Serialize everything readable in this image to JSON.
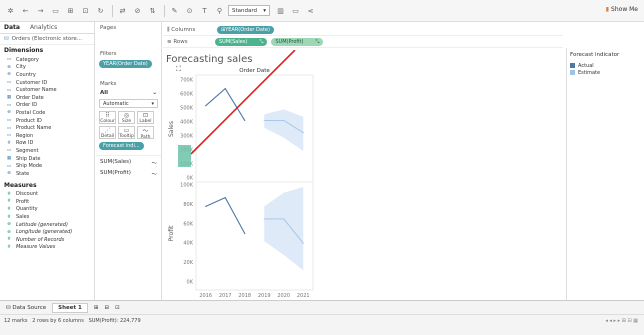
{
  "toolbar": {
    "format_value": "Standard",
    "show_me_label": "Show Me"
  },
  "left_panel": {
    "tab_data": "Data",
    "tab_analytics": "Analytics",
    "datasource": "Orders (Electronic store...",
    "dimensions_title": "Dimensions",
    "dimensions": [
      "Category",
      "City",
      "Country",
      "Customer ID",
      "Customer Name",
      "Order Date",
      "Order ID",
      "Postal Code",
      "Product ID",
      "Product Name",
      "Region",
      "Row ID",
      "Segment",
      "Ship Date",
      "Ship Mode",
      "State"
    ],
    "measures_title": "Measures",
    "measures": [
      "Discount",
      "Profit",
      "Quantity",
      "Sales",
      "Latitude (generated)",
      "Longitude (generated)",
      "Number of Records",
      "Measure Values"
    ]
  },
  "cards": {
    "pages_title": "Pages",
    "filters_title": "Filters",
    "filter_pill": "YEAR(Order Date)",
    "marks_title": "Marks",
    "all_label": "All",
    "mark_type": "Automatic",
    "btn_colour": "Colour",
    "btn_size": "Size",
    "btn_label": "Label",
    "btn_detail": "Detail",
    "btn_tooltip": "Tooltip",
    "btn_path": "Path",
    "forecast_pill": "Forecast indi...",
    "sum_sales": "SUM(Sales)",
    "sum_profit": "SUM(Profit)"
  },
  "shelves": {
    "columns_label": "Columns",
    "columns_pill": "YEAR(Order Date)",
    "rows_label": "Rows",
    "rows_pill_1": "SUM(Sales)",
    "rows_pill_2": "SUM(Profit)"
  },
  "viz": {
    "title": "Forecasting sales",
    "header": "Order Date",
    "sales_axis_label": "Sales",
    "profit_axis_label": "Profit"
  },
  "legend": {
    "title": "Forecast indicator",
    "items": [
      {
        "label": "Actual",
        "color": "#4e79a7"
      },
      {
        "label": "Estimate",
        "color": "#a0c4e8"
      }
    ]
  },
  "bottom": {
    "data_source_tab": "Data Source",
    "sheet_tab": "Sheet 1"
  },
  "status": {
    "marks": "12 marks",
    "rows_cols": "2 rows by 6 columns",
    "sum": "SUM(Profit): 224,779"
  },
  "chart_data": [
    {
      "type": "line",
      "ylabel": "Sales",
      "x": [
        "2016",
        "2017",
        "2018",
        "2019",
        "2020",
        "2021"
      ],
      "ylim": [
        0,
        800000
      ],
      "yticks": [
        "0K",
        "100K",
        "200K",
        "300K",
        "400K",
        "500K",
        "600K",
        "700K"
      ],
      "series": [
        {
          "name": "Actual",
          "values": [
            590000,
            730000,
            470000,
            null,
            null,
            null
          ]
        },
        {
          "name": "Estimate",
          "values": [
            null,
            null,
            null,
            470000,
            470000,
            370000
          ],
          "band_low": [
            null,
            null,
            null,
            410000,
            330000,
            220000
          ],
          "band_high": [
            null,
            null,
            null,
            520000,
            560000,
            500000
          ]
        }
      ]
    },
    {
      "type": "line",
      "ylabel": "Profit",
      "x": [
        "2016",
        "2017",
        "2018",
        "2019",
        "2020",
        "2021"
      ],
      "ylim": [
        0,
        100000
      ],
      "yticks": [
        "0K",
        "20K",
        "40K",
        "60K",
        "80K",
        "100K"
      ],
      "series": [
        {
          "name": "Actual",
          "values": [
            78000,
            87000,
            50000,
            null,
            null,
            null
          ]
        },
        {
          "name": "Estimate",
          "values": [
            null,
            null,
            null,
            65000,
            65000,
            40000
          ],
          "band_low": [
            null,
            null,
            null,
            42000,
            28000,
            12000
          ],
          "band_high": [
            null,
            null,
            null,
            78000,
            92000,
            98000
          ]
        }
      ]
    }
  ]
}
